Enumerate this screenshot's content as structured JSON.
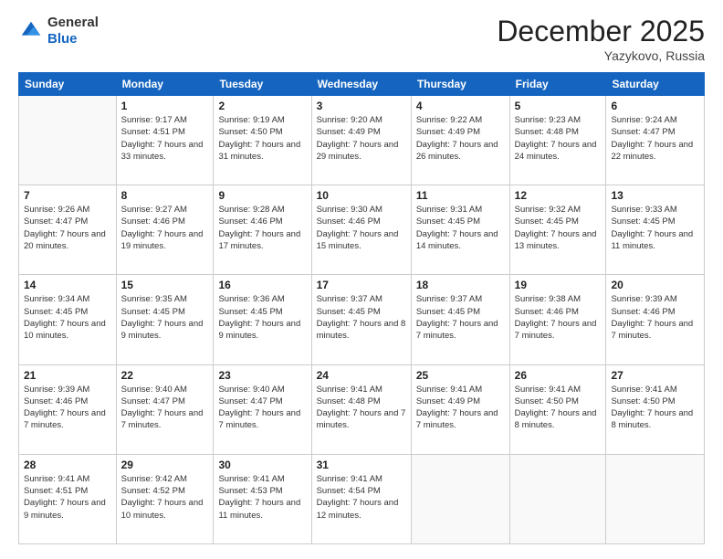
{
  "logo": {
    "general": "General",
    "blue": "Blue"
  },
  "title": "December 2025",
  "location": "Yazykovo, Russia",
  "days": [
    "Sunday",
    "Monday",
    "Tuesday",
    "Wednesday",
    "Thursday",
    "Friday",
    "Saturday"
  ],
  "weeks": [
    [
      {
        "date": "",
        "sunrise": "",
        "sunset": "",
        "daylight": "",
        "empty": true
      },
      {
        "date": "1",
        "sunrise": "Sunrise: 9:17 AM",
        "sunset": "Sunset: 4:51 PM",
        "daylight": "Daylight: 7 hours and 33 minutes."
      },
      {
        "date": "2",
        "sunrise": "Sunrise: 9:19 AM",
        "sunset": "Sunset: 4:50 PM",
        "daylight": "Daylight: 7 hours and 31 minutes."
      },
      {
        "date": "3",
        "sunrise": "Sunrise: 9:20 AM",
        "sunset": "Sunset: 4:49 PM",
        "daylight": "Daylight: 7 hours and 29 minutes."
      },
      {
        "date": "4",
        "sunrise": "Sunrise: 9:22 AM",
        "sunset": "Sunset: 4:49 PM",
        "daylight": "Daylight: 7 hours and 26 minutes."
      },
      {
        "date": "5",
        "sunrise": "Sunrise: 9:23 AM",
        "sunset": "Sunset: 4:48 PM",
        "daylight": "Daylight: 7 hours and 24 minutes."
      },
      {
        "date": "6",
        "sunrise": "Sunrise: 9:24 AM",
        "sunset": "Sunset: 4:47 PM",
        "daylight": "Daylight: 7 hours and 22 minutes."
      }
    ],
    [
      {
        "date": "7",
        "sunrise": "Sunrise: 9:26 AM",
        "sunset": "Sunset: 4:47 PM",
        "daylight": "Daylight: 7 hours and 20 minutes."
      },
      {
        "date": "8",
        "sunrise": "Sunrise: 9:27 AM",
        "sunset": "Sunset: 4:46 PM",
        "daylight": "Daylight: 7 hours and 19 minutes."
      },
      {
        "date": "9",
        "sunrise": "Sunrise: 9:28 AM",
        "sunset": "Sunset: 4:46 PM",
        "daylight": "Daylight: 7 hours and 17 minutes."
      },
      {
        "date": "10",
        "sunrise": "Sunrise: 9:30 AM",
        "sunset": "Sunset: 4:46 PM",
        "daylight": "Daylight: 7 hours and 15 minutes."
      },
      {
        "date": "11",
        "sunrise": "Sunrise: 9:31 AM",
        "sunset": "Sunset: 4:45 PM",
        "daylight": "Daylight: 7 hours and 14 minutes."
      },
      {
        "date": "12",
        "sunrise": "Sunrise: 9:32 AM",
        "sunset": "Sunset: 4:45 PM",
        "daylight": "Daylight: 7 hours and 13 minutes."
      },
      {
        "date": "13",
        "sunrise": "Sunrise: 9:33 AM",
        "sunset": "Sunset: 4:45 PM",
        "daylight": "Daylight: 7 hours and 11 minutes."
      }
    ],
    [
      {
        "date": "14",
        "sunrise": "Sunrise: 9:34 AM",
        "sunset": "Sunset: 4:45 PM",
        "daylight": "Daylight: 7 hours and 10 minutes."
      },
      {
        "date": "15",
        "sunrise": "Sunrise: 9:35 AM",
        "sunset": "Sunset: 4:45 PM",
        "daylight": "Daylight: 7 hours and 9 minutes."
      },
      {
        "date": "16",
        "sunrise": "Sunrise: 9:36 AM",
        "sunset": "Sunset: 4:45 PM",
        "daylight": "Daylight: 7 hours and 9 minutes."
      },
      {
        "date": "17",
        "sunrise": "Sunrise: 9:37 AM",
        "sunset": "Sunset: 4:45 PM",
        "daylight": "Daylight: 7 hours and 8 minutes."
      },
      {
        "date": "18",
        "sunrise": "Sunrise: 9:37 AM",
        "sunset": "Sunset: 4:45 PM",
        "daylight": "Daylight: 7 hours and 7 minutes."
      },
      {
        "date": "19",
        "sunrise": "Sunrise: 9:38 AM",
        "sunset": "Sunset: 4:46 PM",
        "daylight": "Daylight: 7 hours and 7 minutes."
      },
      {
        "date": "20",
        "sunrise": "Sunrise: 9:39 AM",
        "sunset": "Sunset: 4:46 PM",
        "daylight": "Daylight: 7 hours and 7 minutes."
      }
    ],
    [
      {
        "date": "21",
        "sunrise": "Sunrise: 9:39 AM",
        "sunset": "Sunset: 4:46 PM",
        "daylight": "Daylight: 7 hours and 7 minutes."
      },
      {
        "date": "22",
        "sunrise": "Sunrise: 9:40 AM",
        "sunset": "Sunset: 4:47 PM",
        "daylight": "Daylight: 7 hours and 7 minutes."
      },
      {
        "date": "23",
        "sunrise": "Sunrise: 9:40 AM",
        "sunset": "Sunset: 4:47 PM",
        "daylight": "Daylight: 7 hours and 7 minutes."
      },
      {
        "date": "24",
        "sunrise": "Sunrise: 9:41 AM",
        "sunset": "Sunset: 4:48 PM",
        "daylight": "Daylight: 7 hours and 7 minutes."
      },
      {
        "date": "25",
        "sunrise": "Sunrise: 9:41 AM",
        "sunset": "Sunset: 4:49 PM",
        "daylight": "Daylight: 7 hours and 7 minutes."
      },
      {
        "date": "26",
        "sunrise": "Sunrise: 9:41 AM",
        "sunset": "Sunset: 4:50 PM",
        "daylight": "Daylight: 7 hours and 8 minutes."
      },
      {
        "date": "27",
        "sunrise": "Sunrise: 9:41 AM",
        "sunset": "Sunset: 4:50 PM",
        "daylight": "Daylight: 7 hours and 8 minutes."
      }
    ],
    [
      {
        "date": "28",
        "sunrise": "Sunrise: 9:41 AM",
        "sunset": "Sunset: 4:51 PM",
        "daylight": "Daylight: 7 hours and 9 minutes."
      },
      {
        "date": "29",
        "sunrise": "Sunrise: 9:42 AM",
        "sunset": "Sunset: 4:52 PM",
        "daylight": "Daylight: 7 hours and 10 minutes."
      },
      {
        "date": "30",
        "sunrise": "Sunrise: 9:41 AM",
        "sunset": "Sunset: 4:53 PM",
        "daylight": "Daylight: 7 hours and 11 minutes."
      },
      {
        "date": "31",
        "sunrise": "Sunrise: 9:41 AM",
        "sunset": "Sunset: 4:54 PM",
        "daylight": "Daylight: 7 hours and 12 minutes."
      },
      {
        "date": "",
        "sunrise": "",
        "sunset": "",
        "daylight": "",
        "empty": true
      },
      {
        "date": "",
        "sunrise": "",
        "sunset": "",
        "daylight": "",
        "empty": true
      },
      {
        "date": "",
        "sunrise": "",
        "sunset": "",
        "daylight": "",
        "empty": true
      }
    ]
  ]
}
